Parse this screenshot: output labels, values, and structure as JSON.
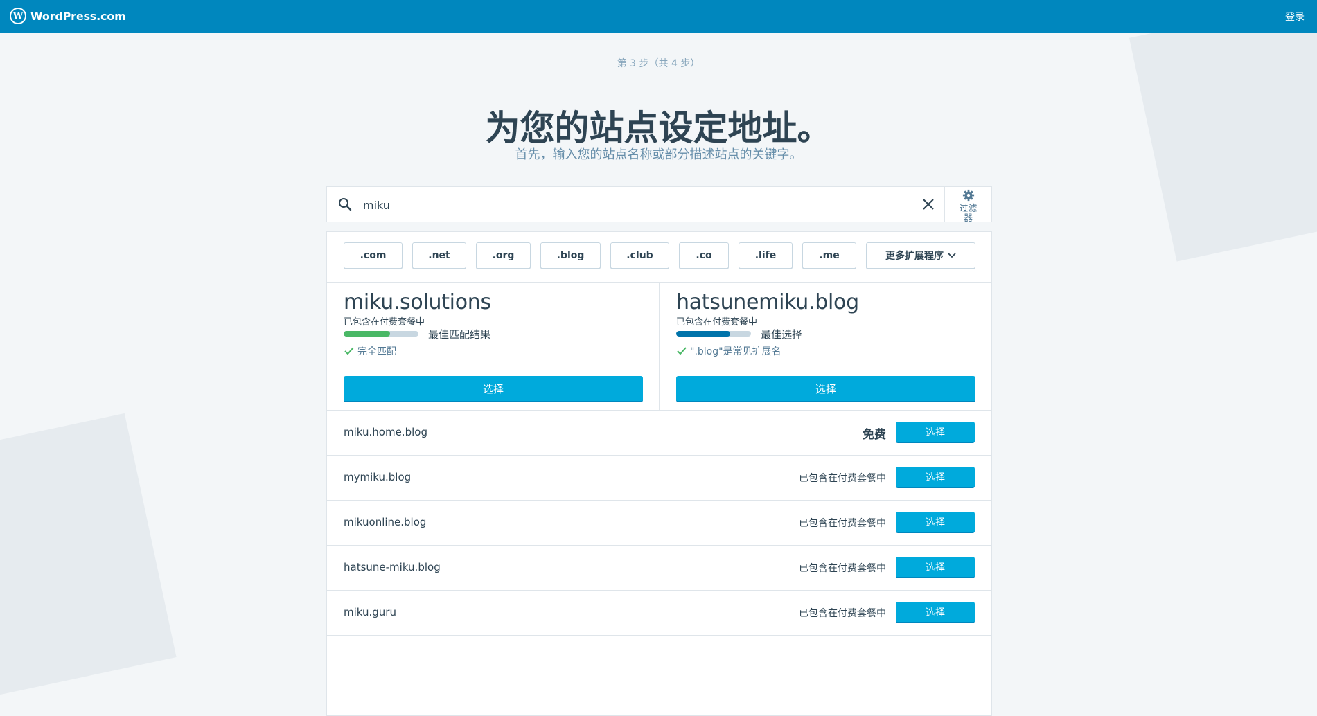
{
  "header": {
    "brand": "WordPress.com",
    "brand_icon": "wordpress-logo-icon",
    "login": "登录"
  },
  "step": "第 3 步（共 4 步）",
  "headline": "为您的站点设定地址。",
  "subheadline": "首先，输入您的站点名称或部分描述站点的关键字。",
  "search": {
    "value": "miku",
    "filter_label": "过滤器"
  },
  "tlds": [
    ".com",
    ".net",
    ".org",
    ".blog",
    ".club",
    ".co",
    ".life",
    ".me"
  ],
  "more_extensions": "更多扩展程序",
  "featured": [
    {
      "domain": "miku.solutions",
      "included": "已包含在付费套餐中",
      "rank_label": "最佳匹配结果",
      "rank_level": 0.62,
      "bar_color": "#4ab866",
      "note": "完全匹配",
      "select": "选择"
    },
    {
      "domain": "hatsunemiku.blog",
      "included": "已包含在付费套餐中",
      "rank_label": "最佳选择",
      "rank_level": 0.72,
      "bar_color": "#0073aa",
      "note": "\".blog\"是常见扩展名",
      "select": "选择"
    }
  ],
  "suggestions": [
    {
      "domain": "miku.home.blog",
      "price": "免费",
      "select": "选择"
    },
    {
      "domain": "mymiku.blog",
      "price": "已包含在付费套餐中",
      "select": "选择"
    },
    {
      "domain": "mikuonline.blog",
      "price": "已包含在付费套餐中",
      "select": "选择"
    },
    {
      "domain": "hatsune-miku.blog",
      "price": "已包含在付费套餐中",
      "select": "选择"
    },
    {
      "domain": "miku.guru",
      "price": "已包含在付费套餐中",
      "select": "选择"
    }
  ],
  "colors": {
    "header_bg": "#0087be",
    "primary_button": "#00aadc",
    "text": "#2e4453",
    "check": "#4ab866"
  }
}
